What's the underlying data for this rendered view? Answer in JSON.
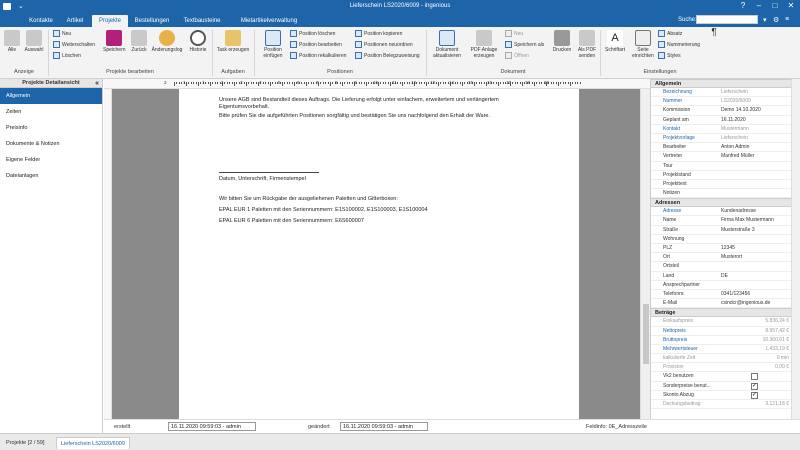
{
  "window": {
    "title": "Lieferschein LS2020/6009 - ingenious",
    "help": "?"
  },
  "tabs": [
    "Kontakte",
    "Artikel",
    "Projekte",
    "Bestellungen",
    "Textbausteine",
    "Mietartikelverwaltung"
  ],
  "search_label": "Suche:",
  "ribbon": {
    "alle": "Alle",
    "auswahl": "Auswahl",
    "neu": "Neu",
    "weiterschalten": "Weiterschalten",
    "loeschen": "Löschen",
    "speichern": "Speichern",
    "zurueck": "Zurück",
    "aenderungslog": "Änderungslog",
    "historie": "Historie",
    "task": "Task erzeugen",
    "position_einfuegen": "Position einfügen",
    "pos_loeschen": "Position löschen",
    "pos_bearbeiten": "Position bearbeiten",
    "pos_rekalk": "Position rekalkulieren",
    "pos_kopieren": "Position kopieren",
    "pos_neuordnen": "Positionen neuordnen",
    "pos_beleg": "Position Belegzuweisung",
    "dok_aktualisieren": "Dokument aktualisieren",
    "pdf_anlage": "PDF Anlage erzeugen",
    "d_neu": "Neu",
    "speichern_als": "Speichern als",
    "oeffnen": "Öffnen",
    "drucken": "Drucken",
    "als_pdf": "Als PDF senden",
    "schriftart": "Schriftart",
    "seite_einrichten": "Seite einrichten",
    "absatz": "Absatz",
    "nummerierung": "Nummerierung",
    "styles": "Styles",
    "g_anzeige": "Anzeige",
    "g_projekte": "Projekte bearbeiten",
    "g_aufgaben": "Aufgaben",
    "g_positionen": "Positionen",
    "g_dokument": "Dokument",
    "g_einstellungen": "Einstellungen"
  },
  "left": {
    "header": "Projekte Detailansicht",
    "items": [
      "Allgemein",
      "Zeiten",
      "Preisinfo",
      "Dokumente & Notizen",
      "Eigene Felder",
      "Dateianlagen"
    ]
  },
  "ruler": [
    "2",
    "1",
    "1",
    "2",
    "3",
    "4",
    "5",
    "6",
    "7",
    "8",
    "9",
    "10",
    "11",
    "12",
    "13",
    "14",
    "15",
    "16",
    "17",
    "18",
    "19"
  ],
  "document": {
    "lines": [
      "Unsere AGB sind Bestandteil dieses Auftrags. Die Lieferung erfolgt unter einfachem, erweitertem und verlängertem",
      "Eigentumsvorbehalt.",
      "Bitte prüfen Sie die aufgeführten Positionen sorgfältig und bestätigen Sie uns nachfolgend den Erhalt der Ware.",
      "Datum, Unterschrift, Firmenstempel",
      "Wir bitten Sie um Rückgabe der ausgeliehenen Paletten und Gitterboxen:",
      "EPAL EUR 1 Paletten mit den Seriennummern: E1S100002, E1S100003, E1S100004",
      "EPAL EUR 6 Paletten mit den Seriennummern: E6S600007"
    ]
  },
  "props": {
    "allgemein": {
      "title": "Allgemein",
      "rows": [
        {
          "k": "Bezeichnung",
          "v": "Lieferschein",
          "kc": "blue",
          "vc": "gray"
        },
        {
          "k": "Nummer",
          "v": "LS2020/6009",
          "kc": "blue",
          "vc": "gray"
        },
        {
          "k": "Kommission",
          "v": "Demo 14.10.2020",
          "dd": "▾"
        },
        {
          "k": "Geplant am",
          "v": "16.11.2020",
          "dd": "▾"
        },
        {
          "k": "Kontakt",
          "v": "Mustermann",
          "kc": "blue",
          "vc": "gray",
          "dd": "⋯"
        },
        {
          "k": "Projektvorlage",
          "v": "Lieferschein",
          "kc": "blue",
          "vc": "gray"
        },
        {
          "k": "Bearbeiter",
          "v": "Anton Admin",
          "dd": "▾"
        },
        {
          "k": "Vertreter",
          "v": "Manfred Müller",
          "dd": "▾"
        },
        {
          "k": "Tour",
          "v": "",
          "dd": "▾"
        },
        {
          "k": "Projektstand",
          "v": "",
          "dd": "▾"
        },
        {
          "k": "Projekttext",
          "v": "",
          "dd": "▾"
        },
        {
          "k": "Notizen",
          "v": "",
          "dd": "▾"
        }
      ]
    },
    "adressen": {
      "title": "Adressen",
      "rows": [
        {
          "k": "Adresse",
          "v": "Kundenadresse",
          "kc": "blue",
          "dd": "▾"
        },
        {
          "k": "Name",
          "v": "Firma Max Mustermann"
        },
        {
          "k": "Straße",
          "v": "Musterstraße 3"
        },
        {
          "k": "Wohnung",
          "v": ""
        },
        {
          "k": "PLZ",
          "v": "12345"
        },
        {
          "k": "Ort",
          "v": "Musterort"
        },
        {
          "k": "Ortsteil",
          "v": ""
        },
        {
          "k": "Land",
          "v": "DE"
        },
        {
          "k": "Ansprechpartner",
          "v": ""
        },
        {
          "k": "Telefonnr.",
          "v": "0341/123456",
          "dd": "▾"
        },
        {
          "k": "E-Mail",
          "v": "csindcr@ingenious.de",
          "dd": "⋯"
        }
      ]
    },
    "betraege": {
      "title": "Beträge",
      "rows": [
        {
          "k": "Einkaufspreis",
          "v": "5.836,24 €",
          "kc": "gray",
          "vc": "gray",
          "num": true
        },
        {
          "k": "Nettopreis",
          "v": "8.957,42 €",
          "kc": "blue",
          "vc": "gray",
          "num": true
        },
        {
          "k": "Bruttopreis",
          "v": "10.360,61 €",
          "kc": "blue",
          "vc": "gray",
          "num": true
        },
        {
          "k": "Mehrwertsteuer",
          "v": "1.433,19 €",
          "kc": "blue",
          "vc": "gray",
          "num": true
        },
        {
          "k": "kalkulierte Zeit",
          "v": "0 min",
          "kc": "gray",
          "vc": "gray",
          "num": true
        },
        {
          "k": "Provision",
          "v": "0,00 €",
          "kc": "gray",
          "vc": "gray",
          "num": true
        },
        {
          "k": "Vk2 benutzen",
          "chk": ""
        },
        {
          "k": "Sonderpreise benut...",
          "chk": "✓"
        },
        {
          "k": "Skonto Abzug",
          "chk": "✓"
        },
        {
          "k": "Deckungsbeitrag",
          "v": "3.121,18 €",
          "kc": "gray",
          "vc": "gray",
          "num": true
        }
      ]
    }
  },
  "footer": {
    "erstellt_label": "erstellt",
    "erstellt_value": "16.11.2020 09:59:03 - admin",
    "geaendert_label": "geändert",
    "geaendert_value": "16.11.2020 09:59:03 - admin",
    "feldinfo": "Feldinfo: 0E_Adresszeile"
  },
  "statusbar": {
    "tab1": "Projekte [2 / 59]",
    "tab2": "Lieferschein LS2020/6009"
  }
}
